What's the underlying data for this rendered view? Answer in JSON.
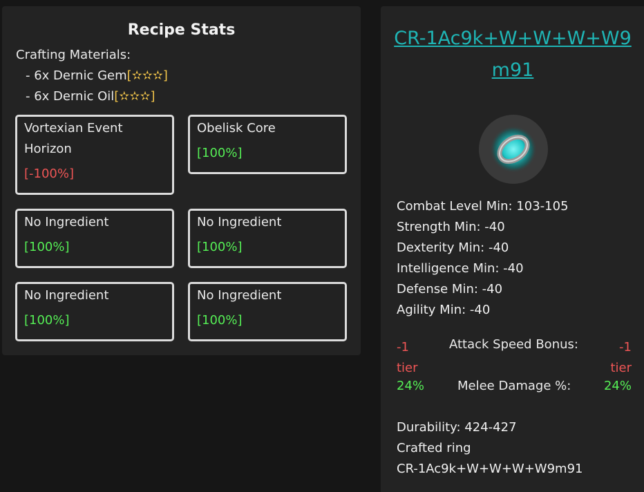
{
  "recipe": {
    "title": "Recipe Stats",
    "materials_header": "Crafting Materials:",
    "materials": [
      {
        "text": "- 6x Dernic Gem",
        "stars": "[✫✫✫]"
      },
      {
        "text": "- 6x Dernic Oil",
        "stars": "[✫✫✫]"
      }
    ],
    "ingredients": [
      {
        "name": "Vortexian Event Horizon",
        "effectiveness": "[-100%]"
      },
      {
        "name": "Obelisk Core",
        "effectiveness": "[100%]"
      },
      {
        "name": "No Ingredient",
        "effectiveness": "[100%]"
      },
      {
        "name": "No Ingredient",
        "effectiveness": "[100%]"
      },
      {
        "name": "No Ingredient",
        "effectiveness": "[100%]"
      },
      {
        "name": "No Ingredient",
        "effectiveness": "[100%]"
      }
    ]
  },
  "item": {
    "name": "CR-1Ac9k+W+W+W+W9m91",
    "icon": "ring-icon",
    "requirements": [
      "Combat Level Min: 103-105",
      "Strength Min: -40",
      "Dexterity Min: -40",
      "Intelligence Min: -40",
      "Defense Min: -40",
      "Agility Min: -40"
    ],
    "ids": [
      {
        "min": "-1 tier",
        "label": "Attack Speed Bonus:",
        "max": "-1 tier"
      },
      {
        "min": "24%",
        "label": "Melee Damage %:",
        "max": "24%"
      }
    ],
    "durability": "Durability: 424-427",
    "type_label": "Crafted ring",
    "hash": "CR-1Ac9k+W+W+W+W9m91"
  },
  "colors": {
    "positive": "#55ee55",
    "negative": "#ee5555",
    "accent": "#1fb5b5",
    "star": "#f0c34a"
  }
}
